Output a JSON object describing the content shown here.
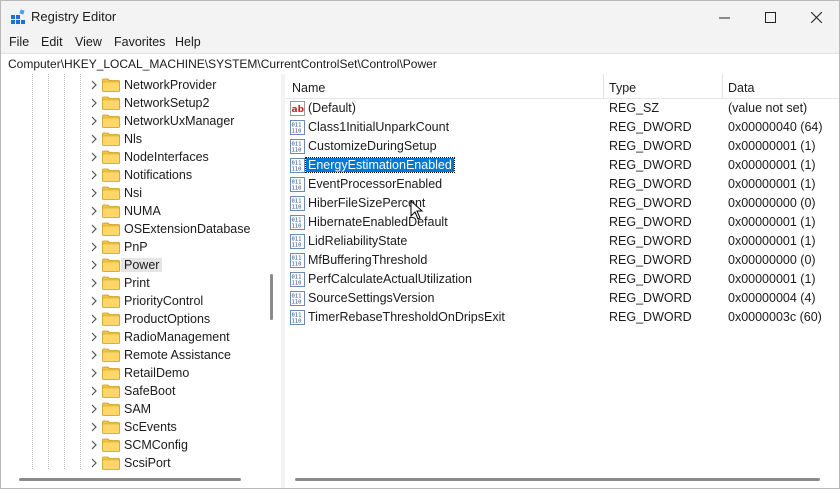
{
  "window": {
    "title": "Registry Editor"
  },
  "menu": [
    "File",
    "Edit",
    "View",
    "Favorites",
    "Help"
  ],
  "address": "Computer\\HKEY_LOCAL_MACHINE\\SYSTEM\\CurrentControlSet\\Control\\Power",
  "tree": {
    "items": [
      "NetworkProvider",
      "NetworkSetup2",
      "NetworkUxManager",
      "Nls",
      "NodeInterfaces",
      "Notifications",
      "Nsi",
      "NUMA",
      "OSExtensionDatabase",
      "PnP",
      "Power",
      "Print",
      "PriorityControl",
      "ProductOptions",
      "RadioManagement",
      "Remote Assistance",
      "RetailDemo",
      "SafeBoot",
      "SAM",
      "ScEvents",
      "SCMConfig",
      "ScsiPort"
    ],
    "selected": "Power"
  },
  "list": {
    "columns": {
      "name": "Name",
      "type": "Type",
      "data": "Data"
    },
    "rows": [
      {
        "icon": "string-value-icon",
        "name": "(Default)",
        "type": "REG_SZ",
        "data": "(value not set)"
      },
      {
        "icon": "binary-value-icon",
        "name": "Class1InitialUnparkCount",
        "type": "REG_DWORD",
        "data": "0x00000040 (64)"
      },
      {
        "icon": "binary-value-icon",
        "name": "CustomizeDuringSetup",
        "type": "REG_DWORD",
        "data": "0x00000001 (1)"
      },
      {
        "icon": "binary-value-icon",
        "name": "EnergyEstimationEnabled",
        "type": "REG_DWORD",
        "data": "0x00000001 (1)",
        "selected": true
      },
      {
        "icon": "binary-value-icon",
        "name": "EventProcessorEnabled",
        "type": "REG_DWORD",
        "data": "0x00000001 (1)"
      },
      {
        "icon": "binary-value-icon",
        "name": "HiberFileSizePercent",
        "type": "REG_DWORD",
        "data": "0x00000000 (0)"
      },
      {
        "icon": "binary-value-icon",
        "name": "HibernateEnabledDefault",
        "type": "REG_DWORD",
        "data": "0x00000001 (1)"
      },
      {
        "icon": "binary-value-icon",
        "name": "LidReliabilityState",
        "type": "REG_DWORD",
        "data": "0x00000001 (1)"
      },
      {
        "icon": "binary-value-icon",
        "name": "MfBufferingThreshold",
        "type": "REG_DWORD",
        "data": "0x00000000 (0)"
      },
      {
        "icon": "binary-value-icon",
        "name": "PerfCalculateActualUtilization",
        "type": "REG_DWORD",
        "data": "0x00000001 (1)"
      },
      {
        "icon": "binary-value-icon",
        "name": "SourceSettingsVersion",
        "type": "REG_DWORD",
        "data": "0x00000004 (4)"
      },
      {
        "icon": "binary-value-icon",
        "name": "TimerRebaseThresholdOnDripsExit",
        "type": "REG_DWORD",
        "data": "0x0000003c (60)"
      }
    ]
  },
  "colors": {
    "selection": "#0078d7",
    "folder": "#f4c542"
  }
}
